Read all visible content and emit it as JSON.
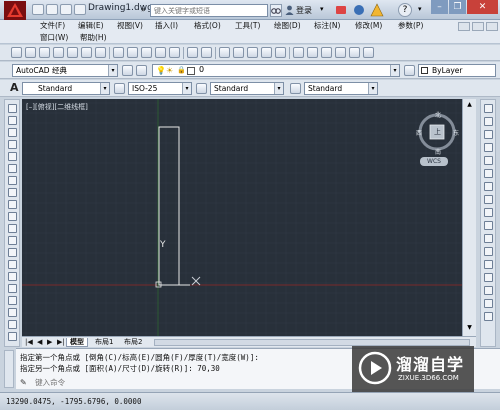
{
  "titlebar": {
    "doc_title": "Drawing1.dwg",
    "search_placeholder": "键入关键字或短语",
    "login": "登录",
    "help_glyph": "?",
    "minimize": "–",
    "restore": "❐",
    "close": "✕"
  },
  "menu": {
    "row1": [
      "文件(F)",
      "编辑(E)",
      "视图(V)",
      "插入(I)",
      "格式(O)",
      "工具(T)",
      "绘图(D)",
      "标注(N)",
      "修改(M)",
      "参数(P)"
    ],
    "row2": [
      "窗口(W)",
      "帮助(H)"
    ]
  },
  "toolbar": {
    "workspace": "AutoCAD 经典",
    "layer": "0",
    "bylayer": "ByLayer",
    "text_style": "Standard",
    "dim_style": "ISO-25",
    "table_style": "Standard",
    "mleader_style": "Standard"
  },
  "viewport": {
    "label": "[–][俯视][二维线框]",
    "compass_top": "北",
    "compass_left": "西",
    "compass_right": "东",
    "compass_bottom": "南",
    "compass_center": "上",
    "wcs": "WCS",
    "ucs_y": "Y"
  },
  "tabs": [
    "模型",
    "布局1",
    "布局2"
  ],
  "tab_nav": [
    "|◀",
    "◀",
    "▶",
    "▶|"
  ],
  "command": {
    "line1": "指定第一个角点或 [倒角(C)/标高(E)/圆角(F)/厚度(T)/宽度(W)]:",
    "line2": "指定另一个角点或 [面积(A)/尺寸(D)/旋转(R)]: 70,30",
    "input_placeholder": "键入命令"
  },
  "status": {
    "coords": "13290.0475, -1795.6796, 0.0000"
  },
  "watermark": {
    "brand": "溜溜自学",
    "url": "ZIXUE.3D66.COM"
  },
  "colors": {
    "canvas": "#28303a",
    "grid": "#323b46",
    "rect_stroke": "#e8e8e8",
    "x_axis": "#7a2a2a",
    "y_axis": "#2d5a34"
  }
}
